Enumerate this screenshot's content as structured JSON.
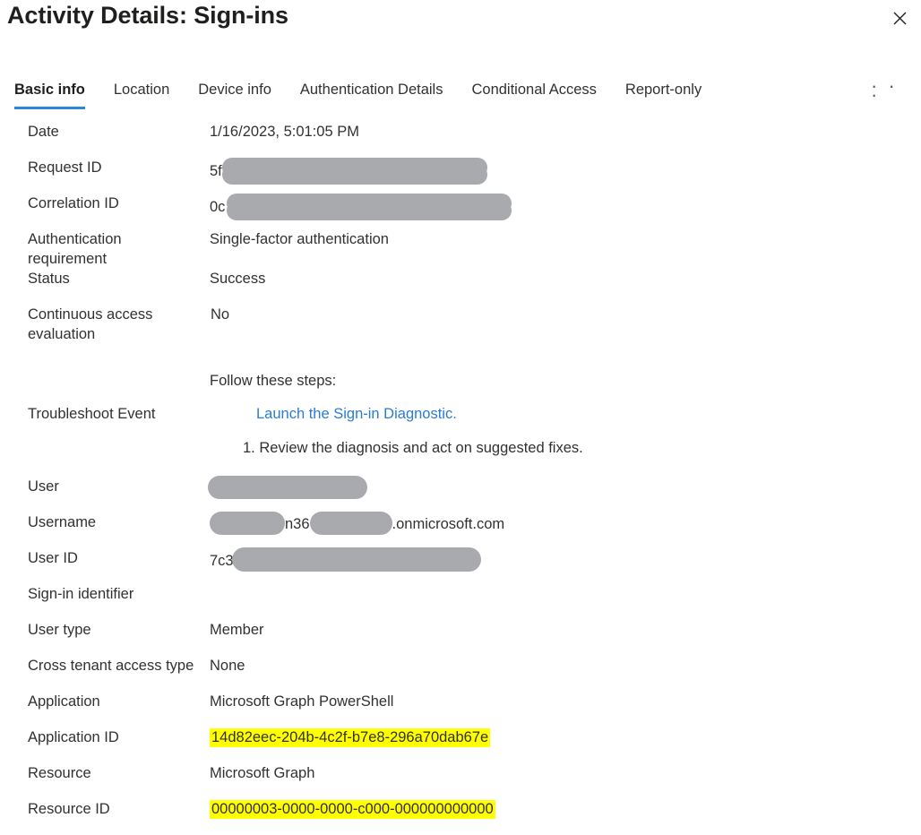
{
  "header": {
    "title": "Activity Details: Sign-ins",
    "close_label": "Close",
    "close_icon": "close-icon"
  },
  "tabs": {
    "items": [
      {
        "label": "Basic info",
        "active": true
      },
      {
        "label": "Location",
        "active": false
      },
      {
        "label": "Device info",
        "active": false
      },
      {
        "label": "Authentication Details",
        "active": false
      },
      {
        "label": "Conditional Access",
        "active": false
      },
      {
        "label": "Report-only",
        "active": false
      }
    ],
    "overflow_label": "· · ·",
    "active_underline_color": "#2b88d8"
  },
  "basic_info": {
    "date": {
      "label": "Date",
      "value": "1/16/2023, 5:01:05 PM"
    },
    "request_id": {
      "label": "Request ID",
      "value_prefix": "5f",
      "redacted": true
    },
    "correlation_id": {
      "label": "Correlation ID",
      "value_prefix": "0c",
      "redacted": true
    },
    "auth_requirement": {
      "label": "Authentication requirement",
      "value": "Single-factor authentication"
    },
    "status": {
      "label": "Status",
      "value": "Success"
    },
    "cae": {
      "label": "Continuous access evaluation",
      "value": "No"
    },
    "troubleshoot": {
      "label": "Troubleshoot Event",
      "intro": "Follow these steps:",
      "link_text": "Launch the Sign-in Diagnostic.",
      "step_1": "1. Review the diagnosis and act on suggested fixes."
    },
    "user": {
      "label": "User",
      "value_prefix": "",
      "redacted": true
    },
    "username": {
      "label": "Username",
      "segment_1_redacted": true,
      "segment_2": "n36",
      "segment_3_redacted": true,
      "segment_4": ".onmicrosoft.com"
    },
    "user_id": {
      "label": "User ID",
      "value_prefix": "7c3",
      "redacted": true
    },
    "signin_identifier": {
      "label": "Sign-in identifier",
      "value": ""
    },
    "user_type": {
      "label": "User type",
      "value": "Member"
    },
    "cross_tenant": {
      "label": "Cross tenant access type",
      "value": "None"
    },
    "application": {
      "label": "Application",
      "value": "Microsoft Graph PowerShell"
    },
    "application_id": {
      "label": "Application ID",
      "value": "14d82eec-204b-4c2f-b7e8-296a70dab67e",
      "highlighted": true
    },
    "resource": {
      "label": "Resource",
      "value": "Microsoft Graph"
    },
    "resource_id": {
      "label": "Resource ID",
      "value": "00000003-0000-0000-c000-000000000000",
      "highlighted": true
    }
  },
  "colors": {
    "link": "#2b7cd3",
    "accent": "#2b88d8",
    "highlight": "#ffff00",
    "redaction": "#a8aaad",
    "text": "#323130"
  }
}
